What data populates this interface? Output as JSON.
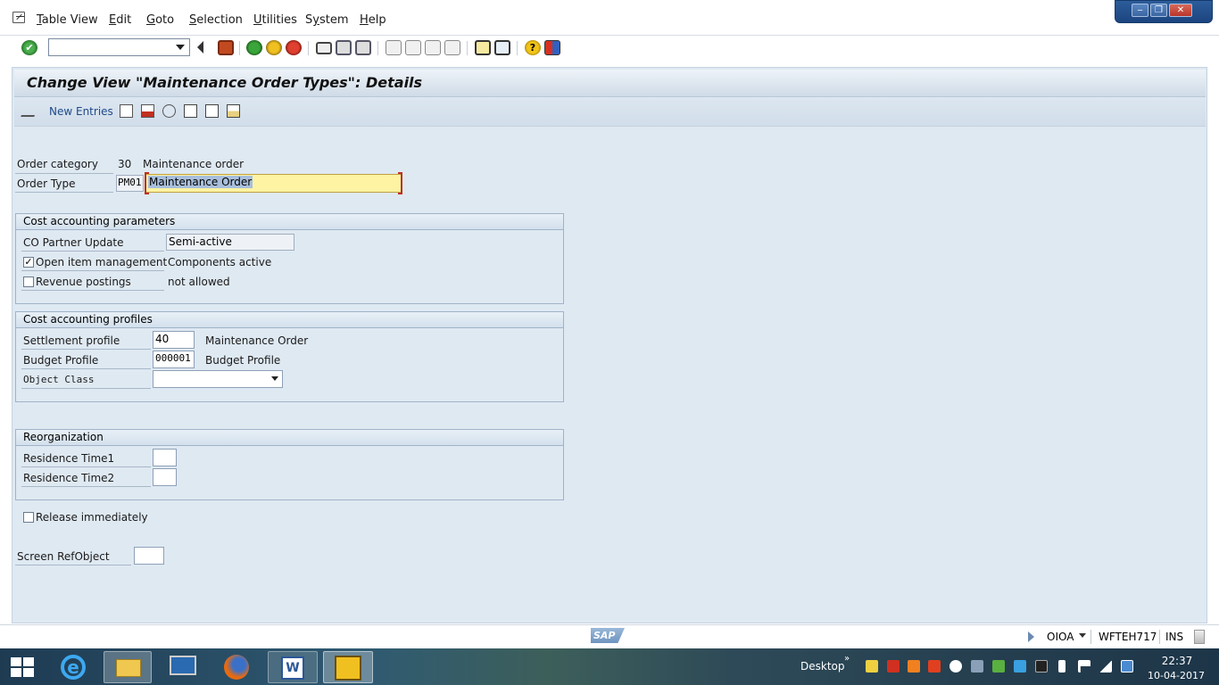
{
  "menu": {
    "items": [
      "Table View",
      "Edit",
      "Goto",
      "Selection",
      "Utilities",
      "System",
      "Help"
    ],
    "underline": [
      "T",
      "E",
      "G",
      "S",
      "U",
      "y",
      "H"
    ]
  },
  "window_controls": {
    "minimize": "‒",
    "restore": "❐",
    "close": "✕"
  },
  "toolbar": {
    "command_field_value": ""
  },
  "title": "Change View \"Maintenance Order Types\": Details",
  "app_toolbar": {
    "new_entries": "New Entries"
  },
  "order": {
    "category_label": "Order category",
    "category_value": "30",
    "category_text": "Maintenance order",
    "type_label": "Order Type",
    "type_value": "PM01",
    "type_text": "Maintenance Order"
  },
  "cost_params": {
    "title": "Cost accounting parameters",
    "co_partner_label": "CO Partner Update",
    "co_partner_value": "Semi-active",
    "open_item_label": "Open item management",
    "open_item_checked": true,
    "open_item_text": "Components active",
    "revenue_label": "Revenue postings",
    "revenue_checked": false,
    "revenue_text": "not allowed"
  },
  "cost_profiles": {
    "title": "Cost accounting profiles",
    "settlement_label": "Settlement profile",
    "settlement_value": "40",
    "settlement_text": "Maintenance Order",
    "budget_label": "Budget Profile",
    "budget_value": "000001",
    "budget_text": "Budget Profile",
    "object_class_label": "Object Class",
    "object_class_value": ""
  },
  "reorg": {
    "title": "Reorganization",
    "res1_label": "Residence Time1",
    "res1_value": "",
    "res2_label": "Residence Time2",
    "res2_value": ""
  },
  "release": {
    "label": "Release immediately",
    "checked": false
  },
  "screen_ref": {
    "label": "Screen RefObject",
    "value": ""
  },
  "status": {
    "logo": "SAP",
    "system": "OIOA",
    "server": "WFTEH717",
    "mode": "INS"
  },
  "taskbar": {
    "desktop_label": "Desktop",
    "time": "22:37",
    "date": "10-04-2017"
  },
  "colors": {
    "highlight_field": "#fdf3a2",
    "selection": "#a8bfdc",
    "panel": "#dfe9f2",
    "taskbar": "#1e3b52"
  }
}
